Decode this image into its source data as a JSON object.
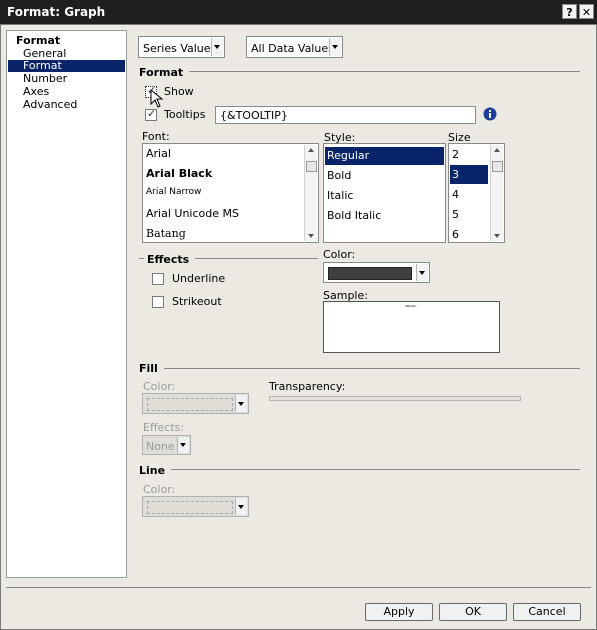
{
  "window": {
    "title": "Format: Graph",
    "help_glyph": "?",
    "close_glyph": "✕"
  },
  "nav": {
    "header": "Format",
    "items": [
      {
        "label": "General"
      },
      {
        "label": "Format"
      },
      {
        "label": "Number"
      },
      {
        "label": "Axes"
      },
      {
        "label": "Advanced"
      }
    ]
  },
  "selectors": {
    "series": "Series Values",
    "scope": "All Data Values"
  },
  "format_section": {
    "title": "Format",
    "show_label": "Show",
    "tooltips_label": "Tooltips",
    "tooltips_value": "{&TOOLTIP}",
    "font_label": "Font:",
    "style_label": "Style:",
    "size_label": "Size",
    "fonts": [
      "Arial",
      "Arial Black",
      "Arial Narrow",
      "Arial Unicode MS",
      "Batang"
    ],
    "styles": [
      "Regular",
      "Bold",
      "Italic",
      "Bold Italic"
    ],
    "sizes": [
      "2",
      "3",
      "4",
      "5",
      "6"
    ],
    "selected_style": "Regular",
    "selected_size": "3"
  },
  "effects": {
    "title": "Effects",
    "underline_label": "Underline",
    "strikeout_label": "Strikeout",
    "color_label": "Color:",
    "sample_label": "Sample:",
    "sample_text": "ABCabc",
    "swatch_color": "#404040"
  },
  "fill": {
    "title": "Fill",
    "color_label": "Color:",
    "transparency_label": "Transparency:",
    "effects_label": "Effects:",
    "effects_value": "None"
  },
  "line": {
    "title": "Line",
    "color_label": "Color:"
  },
  "buttons": {
    "apply": "Apply",
    "ok": "OK",
    "cancel": "Cancel"
  },
  "colors": {
    "selection": "#0a246a",
    "titlebar": "#1f1f1f",
    "info": "#1c3f9e"
  }
}
